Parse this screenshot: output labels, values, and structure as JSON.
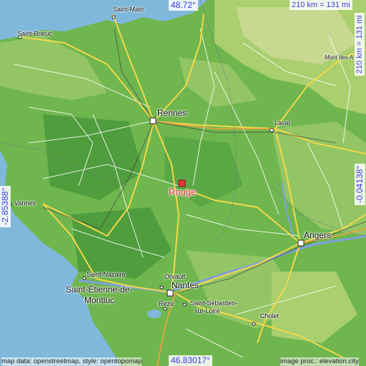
{
  "map": {
    "colors": {
      "sea": "#7fb8da",
      "lowland": "#5aa845",
      "midland": "#7dbf56",
      "upland": "#a9cf6e",
      "highland": "#c8d890",
      "road_major": "#f2d84a",
      "road_minor": "#ffffff",
      "road_trunk": "#f7a13c",
      "rail": "#555555",
      "river": "#7f9fe0",
      "marker": "#e8353b",
      "coord_text": "#3a3ae0"
    },
    "marker": {
      "label": "Rouge",
      "icon": "square-marker-icon"
    },
    "coords": {
      "top_lat": "48.72°",
      "bottom_lat": "46.83017°",
      "left_lon": "-2.85388°",
      "right_lon": "-0.04138°"
    },
    "scale": {
      "horizontal": "210 km = 131 mi",
      "vertical": "210 km = 131 mi"
    },
    "attribution": {
      "left": "map data: openstreetmap, style: opentopomap",
      "right": "image proc.: elevation.city"
    },
    "cities": {
      "saint_malo": "Saint-Malo",
      "saint_brieuc": "Saint-Brieuc",
      "rennes": "Rennes",
      "laval": "Laval",
      "mont_des": "Mont des A",
      "vannes": "Vannes",
      "angers": "Angers",
      "saint_nazaire": "Saint-Nazaire",
      "saint_etienne_1": "Saint-Étienne-de-",
      "saint_etienne_2": "Montluc",
      "orvault": "Orvault",
      "nantes": "Nantes",
      "reze": "Rezé",
      "saint_sebastien_1": "Saint-Sébastien-",
      "saint_sebastien_2": "sur-Loire",
      "cholet": "Cholet"
    }
  }
}
